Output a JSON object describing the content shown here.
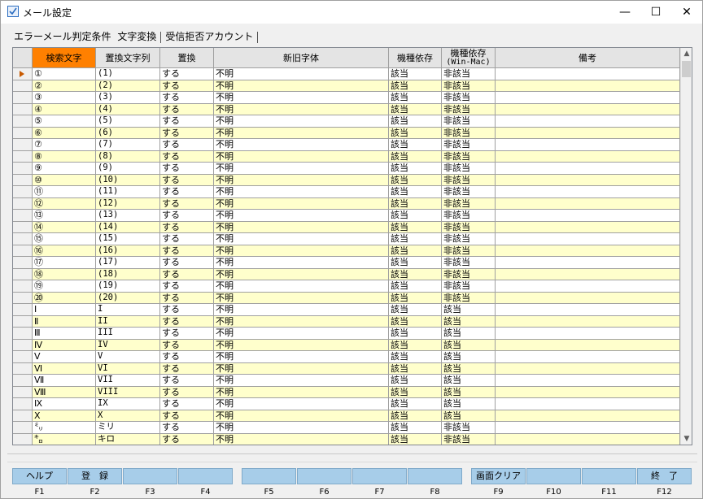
{
  "window": {
    "title": "メール設定",
    "minimize": "—",
    "maximize": "☐",
    "close": "✕"
  },
  "tabs": [
    {
      "label": "エラーメール判定条件"
    },
    {
      "label": "文字変換"
    },
    {
      "label": "受信拒否アカウント"
    }
  ],
  "grid": {
    "columns": [
      {
        "label": "検索文字"
      },
      {
        "label": "置換文字列"
      },
      {
        "label": "置換"
      },
      {
        "label": "新旧字体"
      },
      {
        "label": "機種依存"
      },
      {
        "label": "機種依存",
        "sub": "(Win-Mac)"
      },
      {
        "label": "備考"
      }
    ],
    "rows": [
      [
        "①",
        "(1)",
        "する",
        "不明",
        "該当",
        "非該当",
        ""
      ],
      [
        "②",
        "(2)",
        "する",
        "不明",
        "該当",
        "非該当",
        ""
      ],
      [
        "③",
        "(3)",
        "する",
        "不明",
        "該当",
        "非該当",
        ""
      ],
      [
        "④",
        "(4)",
        "する",
        "不明",
        "該当",
        "非該当",
        ""
      ],
      [
        "⑤",
        "(5)",
        "する",
        "不明",
        "該当",
        "非該当",
        ""
      ],
      [
        "⑥",
        "(6)",
        "する",
        "不明",
        "該当",
        "非該当",
        ""
      ],
      [
        "⑦",
        "(7)",
        "する",
        "不明",
        "該当",
        "非該当",
        ""
      ],
      [
        "⑧",
        "(8)",
        "する",
        "不明",
        "該当",
        "非該当",
        ""
      ],
      [
        "⑨",
        "(9)",
        "する",
        "不明",
        "該当",
        "非該当",
        ""
      ],
      [
        "⑩",
        "(10)",
        "する",
        "不明",
        "該当",
        "非該当",
        ""
      ],
      [
        "⑪",
        "(11)",
        "する",
        "不明",
        "該当",
        "非該当",
        ""
      ],
      [
        "⑫",
        "(12)",
        "する",
        "不明",
        "該当",
        "非該当",
        ""
      ],
      [
        "⑬",
        "(13)",
        "する",
        "不明",
        "該当",
        "非該当",
        ""
      ],
      [
        "⑭",
        "(14)",
        "する",
        "不明",
        "該当",
        "非該当",
        ""
      ],
      [
        "⑮",
        "(15)",
        "する",
        "不明",
        "該当",
        "非該当",
        ""
      ],
      [
        "⑯",
        "(16)",
        "する",
        "不明",
        "該当",
        "非該当",
        ""
      ],
      [
        "⑰",
        "(17)",
        "する",
        "不明",
        "該当",
        "非該当",
        ""
      ],
      [
        "⑱",
        "(18)",
        "する",
        "不明",
        "該当",
        "非該当",
        ""
      ],
      [
        "⑲",
        "(19)",
        "する",
        "不明",
        "該当",
        "非該当",
        ""
      ],
      [
        "⑳",
        "(20)",
        "する",
        "不明",
        "該当",
        "非該当",
        ""
      ],
      [
        "Ⅰ",
        "I",
        "する",
        "不明",
        "該当",
        "該当",
        ""
      ],
      [
        "Ⅱ",
        "II",
        "する",
        "不明",
        "該当",
        "該当",
        ""
      ],
      [
        "Ⅲ",
        "III",
        "する",
        "不明",
        "該当",
        "該当",
        ""
      ],
      [
        "Ⅳ",
        "IV",
        "する",
        "不明",
        "該当",
        "該当",
        ""
      ],
      [
        "Ⅴ",
        "V",
        "する",
        "不明",
        "該当",
        "該当",
        ""
      ],
      [
        "Ⅵ",
        "VI",
        "する",
        "不明",
        "該当",
        "該当",
        ""
      ],
      [
        "Ⅶ",
        "VII",
        "する",
        "不明",
        "該当",
        "該当",
        ""
      ],
      [
        "Ⅷ",
        "VIII",
        "する",
        "不明",
        "該当",
        "該当",
        ""
      ],
      [
        "Ⅸ",
        "IX",
        "する",
        "不明",
        "該当",
        "該当",
        ""
      ],
      [
        "Ⅹ",
        "X",
        "する",
        "不明",
        "該当",
        "該当",
        ""
      ],
      [
        "㍉",
        "ミリ",
        "する",
        "不明",
        "該当",
        "非該当",
        ""
      ],
      [
        "㌔",
        "キロ",
        "する",
        "不明",
        "該当",
        "非該当",
        ""
      ]
    ]
  },
  "scrollbar": {
    "up": "▲",
    "down": "▼"
  },
  "fkeys": [
    {
      "label": "ヘルプ",
      "key": "F1"
    },
    {
      "label": "登　録",
      "key": "F2"
    },
    {
      "label": "",
      "key": "F3"
    },
    {
      "label": "",
      "key": "F4"
    },
    {
      "label": "",
      "key": "F5"
    },
    {
      "label": "",
      "key": "F6"
    },
    {
      "label": "",
      "key": "F7"
    },
    {
      "label": "",
      "key": "F8"
    },
    {
      "label": "画面クリア",
      "key": "F9"
    },
    {
      "label": "",
      "key": "F10"
    },
    {
      "label": "",
      "key": "F11"
    },
    {
      "label": "終　了",
      "key": "F12"
    }
  ],
  "colors": {
    "active_header": "#ff8000",
    "row_alt": "#ffffcc",
    "fkey_bg": "#a7cde9"
  }
}
